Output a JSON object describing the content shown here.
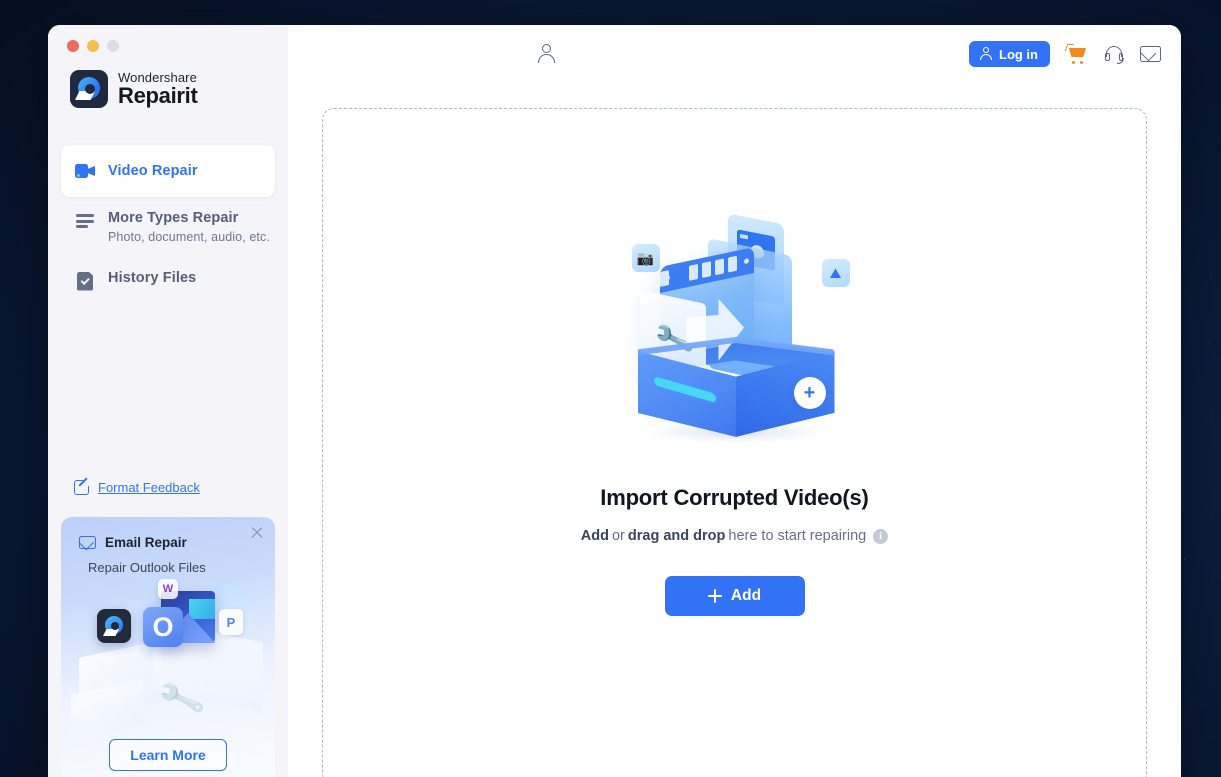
{
  "window": {
    "traffic_lights": [
      "close",
      "minimize",
      "maximize"
    ],
    "brand_top": "Wondershare",
    "brand_bottom": "Repairit"
  },
  "sidebar": {
    "items": [
      {
        "label": "Video Repair",
        "sub": "",
        "icon": "video-camera-icon",
        "active": true
      },
      {
        "label": "More Types Repair",
        "sub": "Photo, document, audio, etc.",
        "icon": "list-lines-icon",
        "active": false
      },
      {
        "label": "History Files",
        "sub": "",
        "icon": "document-check-icon",
        "active": false
      }
    ],
    "feedback_label": "Format Feedback",
    "feedback_icon": "edit-external-link-icon",
    "promo": {
      "icon": "envelope-icon",
      "title": "Email Repair",
      "subtitle": "Repair Outlook Files",
      "button_label": "Learn More",
      "close_icon": "close-icon",
      "art_labels": {
        "word": "W",
        "outlook": "O",
        "powerpoint": "P"
      }
    }
  },
  "topbar": {
    "profile_icon": "user-outline-icon",
    "login_label": "Log in",
    "login_icon": "user-icon",
    "cart_icon": "shopping-cart-icon",
    "support_icon": "headset-icon",
    "mail_icon": "envelope-icon"
  },
  "main": {
    "dropzone": {
      "title": "Import Corrupted Video(s)",
      "subtitle_parts": {
        "add": "Add",
        "or": " or ",
        "drag": "drag and drop",
        "tail": " here to start repairing"
      },
      "info_icon": "info-icon",
      "info_glyph": "i",
      "add_button_label": "Add",
      "add_button_icon": "plus-icon",
      "illustration": "import-box-media-illustration",
      "illustration_badge": "plus-icon"
    }
  },
  "colors": {
    "accent_blue": "#3273f5",
    "cart_orange": "#f08a20",
    "sidebar_bg": "#f5f5f9",
    "dropzone_border": "#aeb6da",
    "text_dark": "#101620",
    "text_muted": "#667084",
    "traffic_red": "#ed6a5e",
    "traffic_yellow": "#f5bf4f",
    "traffic_grey": "#dcdde1",
    "desktop_bg": "#0a1e3d"
  }
}
